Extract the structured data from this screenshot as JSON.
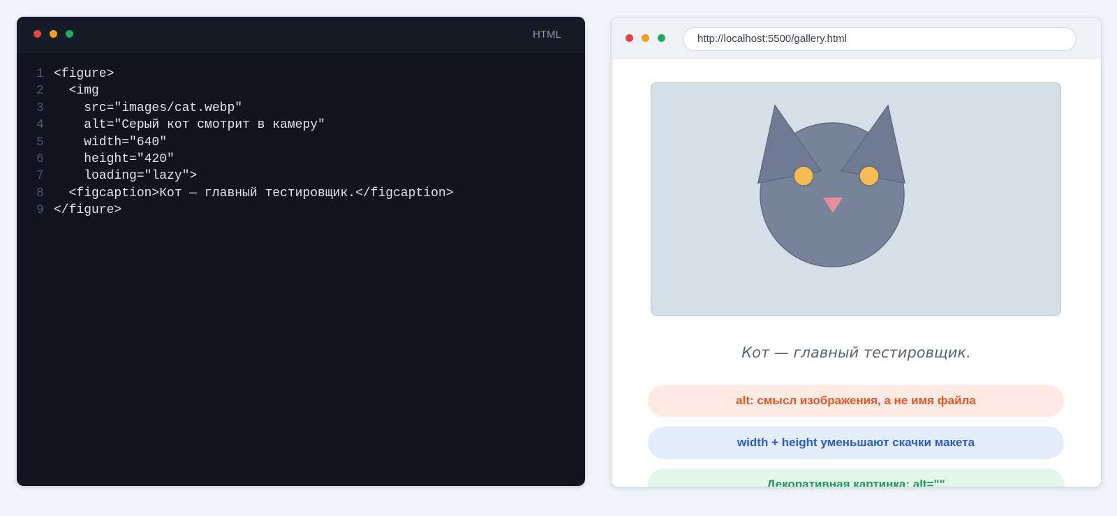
{
  "editor": {
    "language_label": "HTML",
    "lines": [
      {
        "num": "1",
        "text": "<figure>"
      },
      {
        "num": "2",
        "text": "  <img"
      },
      {
        "num": "3",
        "text": "    src=\"images/cat.webp\""
      },
      {
        "num": "4",
        "text": "    alt=\"Серый кот смотрит в камеру\""
      },
      {
        "num": "5",
        "text": "    width=\"640\""
      },
      {
        "num": "6",
        "text": "    height=\"420\""
      },
      {
        "num": "7",
        "text": "    loading=\"lazy\">"
      },
      {
        "num": "8",
        "text": "  <figcaption>Кот — главный тестировщик.</figcaption>"
      },
      {
        "num": "9",
        "text": "</figure>"
      }
    ]
  },
  "browser": {
    "url": "http://localhost:5500/gallery.html",
    "image_icon": "cat-illustration",
    "caption": "Кот — главный тестировщик.",
    "tips": [
      "alt: смысл изображения, а не имя файла",
      "width + height уменьшают скачки макета",
      "Декоративная картинка: alt=\"\""
    ]
  },
  "colors": {
    "window_close": "#e0463f",
    "window_minimize": "#f0a020",
    "window_maximize": "#1faa64",
    "editor_bg": "#0f1420",
    "tip_orange": "#e0582a",
    "tip_blue": "#2b5bc9",
    "tip_green": "#1e9a5c"
  }
}
